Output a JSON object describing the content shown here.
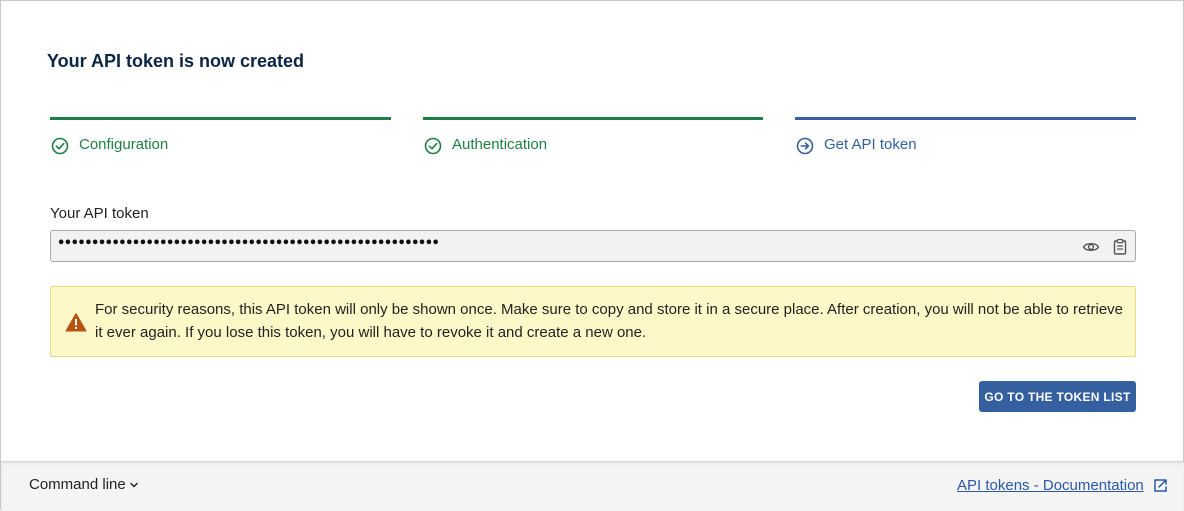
{
  "title": "Your API token is now created",
  "steps": [
    {
      "label": "Configuration",
      "state": "done",
      "icon": "check-circle-icon"
    },
    {
      "label": "Authentication",
      "state": "done",
      "icon": "check-circle-icon"
    },
    {
      "label": "Get API token",
      "state": "current",
      "icon": "arrow-right-circle-icon"
    }
  ],
  "token": {
    "label": "Your API token",
    "masked_value": "••••••••••••••••••••••••••••••••••••••••••••••••••••••••",
    "icons": [
      "eye-icon",
      "clipboard-icon"
    ]
  },
  "warning": {
    "icon": "warning-triangle-icon",
    "text": "For security reasons, this API token will only be shown once. Make sure to copy and store it in a secure place. After creation, you will not be able to retrieve it ever again. If you lose this token, you will have to revoke it and create a new one."
  },
  "actions": {
    "go_to_list": "GO TO THE TOKEN LIST"
  },
  "footer": {
    "command_line": "Command line",
    "doc_link": "API tokens - Documentation"
  },
  "colors": {
    "done": "#1e7f45",
    "current": "#3560a0",
    "title": "#0b2545",
    "warning_bg": "#fdf8c7",
    "warning_icon": "#b8520f"
  }
}
